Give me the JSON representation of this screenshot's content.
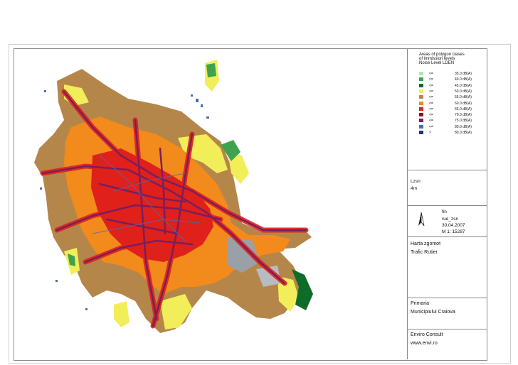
{
  "legend": {
    "title_lines": [
      "Areas of polygon clases",
      "of immission levels",
      "Noise Level LDEN"
    ],
    "classes": [
      {
        "op": "<=",
        "label": "35.0 dB(A)",
        "color": "#b6e3b0"
      },
      {
        "op": "<=",
        "label": "40.0 dB(A)",
        "color": "#3fa34d"
      },
      {
        "op": "<=",
        "label": "45.0 dB(A)",
        "color": "#0e6b2a"
      },
      {
        "op": "<=",
        "label": "50.0 dB(A)",
        "color": "#f2ee5a"
      },
      {
        "op": "<=",
        "label": "55.0 dB(A)",
        "color": "#b5864a"
      },
      {
        "op": "<=",
        "label": "60.0 dB(A)",
        "color": "#f28a1c"
      },
      {
        "op": "<=",
        "label": "65.0 dB(A)",
        "color": "#e0201b"
      },
      {
        "op": "<=",
        "label": "70.0 dB(A)",
        "color": "#8e0d1e"
      },
      {
        "op": "<=",
        "label": "75.0 dB(A)",
        "color": "#7a1e5c"
      },
      {
        "op": "<=",
        "label": "80.0 dB(A)",
        "color": "#4a6fb0"
      },
      {
        "op": ">",
        "label": "80.0 dB(A)",
        "color": "#163e7a"
      }
    ]
  },
  "grid_info": {
    "line1": "Lzsn",
    "line2": "4m"
  },
  "file_info": {
    "line1": "fin",
    "line2": "rue_zsn",
    "date": "30.04.2007",
    "scale": "M 1:  15287"
  },
  "map_title": {
    "line1": "Harta zgomot",
    "line2": "Trafic Rutier"
  },
  "client": {
    "line1": "Primaria",
    "line2": "Municipiului Craiova"
  },
  "author": {
    "line1": "Enviro Consult",
    "line2": "www.envi.ro"
  }
}
